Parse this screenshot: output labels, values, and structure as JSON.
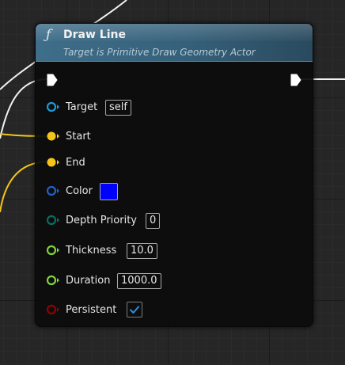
{
  "node": {
    "title": "Draw Line",
    "subtitle": "Target is Primitive Draw Geometry Actor",
    "function_icon": "function-icon"
  },
  "colors": {
    "header": "#3f6e8a",
    "exec": "#ffffff",
    "object_pin": "#1b9bd8",
    "vector_pin": "#f5c418",
    "struct_pin": "#1f62c9",
    "byte_pin": "#0d6b62",
    "float_pin": "#7fd33c",
    "bool_pin": "#930000",
    "color_swatch": "#0000ff"
  },
  "pins": {
    "target": {
      "label": "Target",
      "value": "self"
    },
    "start": {
      "label": "Start"
    },
    "end": {
      "label": "End"
    },
    "color": {
      "label": "Color",
      "value": "#0000FF"
    },
    "depth_priority": {
      "label": "Depth Priority",
      "value": "0"
    },
    "thickness": {
      "label": "Thickness",
      "value": "10.0"
    },
    "duration": {
      "label": "Duration",
      "value": "1000.0"
    },
    "persistent": {
      "label": "Persistent",
      "checked": true
    }
  }
}
